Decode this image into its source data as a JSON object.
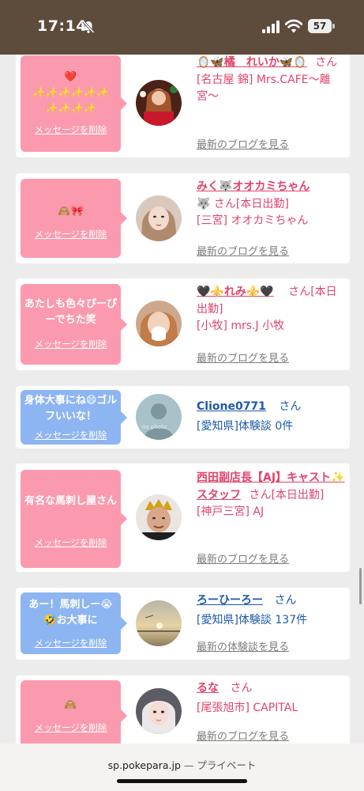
{
  "status_bar": {
    "time": "17:14",
    "battery": "57"
  },
  "feed": {
    "items": [
      {
        "bubble_color": "pink",
        "message": "❤️\n✨✨✨✨✨✨\n✨✨✨✨",
        "delete_label": "メッセージを削除",
        "name": "🪞🦋橘　れいか🦋🪞",
        "san": "さん",
        "status": "",
        "store": "[名古屋 錦] Mrs.CAFE〜離宮〜",
        "link": "最新のブログを見る"
      },
      {
        "bubble_color": "pink",
        "message": "🙈🎀",
        "delete_label": "メッセージを削除",
        "name": "みく🐺オオカミちゃん",
        "name_suffix": "🐺",
        "san": "さん",
        "status": "[本日出勤]",
        "store": "[三宮] オオカミちゃん",
        "link": "最新のブログを見る"
      },
      {
        "bubble_color": "pink",
        "message": "あたしも色々ぴーぴーでちた笑",
        "delete_label": "メッセージを削除",
        "name": "🖤⚜️れみ⚜️🖤",
        "san": "さん",
        "status": "[本日出勤]",
        "store": "[小牧] mrs.J 小牧",
        "link": "最新のブログを見る"
      },
      {
        "bubble_color": "blue",
        "message": "身体大事にね😄ゴルフいいな！",
        "delete_label": "メッセージを削除",
        "name": "Clione0771",
        "san": "さん",
        "status": "",
        "store": "[愛知県]体験談 0件",
        "link": "",
        "avatar_text": "no photo"
      },
      {
        "bubble_color": "pink",
        "message": "有名な馬刺し屋さん",
        "delete_label": "メッセージを削除",
        "name": "西田副店長【AJ】キャスト✨スタッフ",
        "san": "さん",
        "status": "[本日出勤]",
        "store": "[神戸三宮] AJ",
        "link": "最新のブログを見る"
      },
      {
        "bubble_color": "blue",
        "message": "あー！馬刺しー😭🤣お大事に",
        "delete_label": "メッセージを削除",
        "name": "ろーひーろー",
        "san": "さん",
        "status": "",
        "store": "[愛知県]体験談 137件",
        "link": "最新の体験談を見る"
      },
      {
        "bubble_color": "pink",
        "message": "🙈",
        "delete_label": "メッセージを削除",
        "name": "るな",
        "san": "さん",
        "status": "",
        "store": "[尾張旭市] CAPITAL",
        "link": "最新のブログを見る"
      }
    ]
  },
  "browser": {
    "domain": "sp.pokepara.jp",
    "separator": "—",
    "mode": "プライベート"
  },
  "colors": {
    "pink_bubble": "#fb9aae",
    "blue_bubble": "#8db5f1",
    "name_pink": "#e0436a",
    "name_blue": "#1c5aa8",
    "status_bar_bg": "#5d4b3b"
  }
}
